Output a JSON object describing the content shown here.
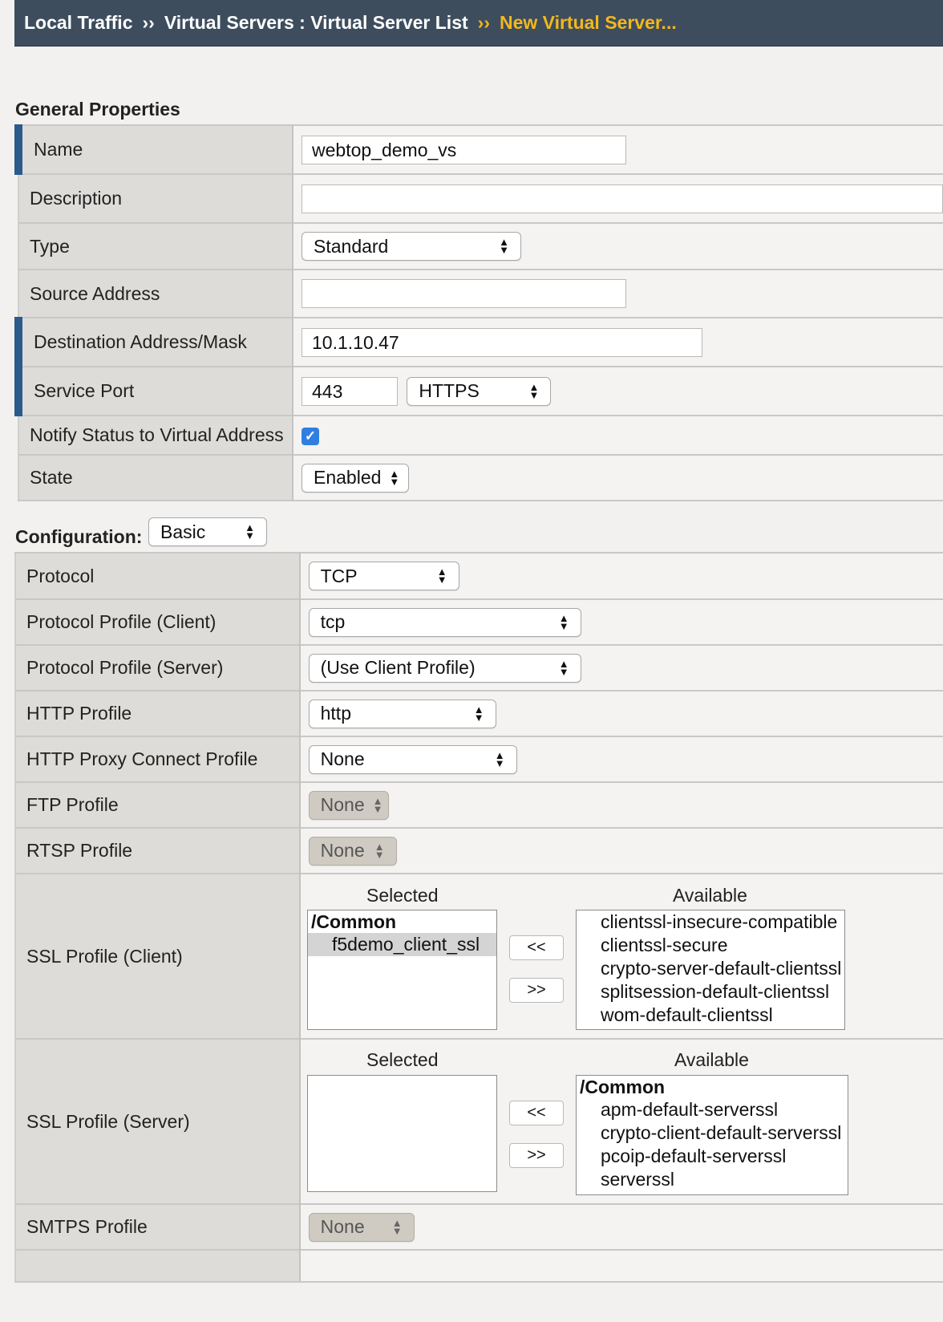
{
  "breadcrumb": {
    "item1": "Local Traffic",
    "sep": "››",
    "item2": "Virtual Servers : Virtual Server List",
    "current": "New Virtual Server..."
  },
  "general": {
    "title": "General Properties",
    "name_label": "Name",
    "name_value": "webtop_demo_vs",
    "description_label": "Description",
    "description_value": "",
    "type_label": "Type",
    "type_value": "Standard",
    "source_label": "Source Address",
    "source_value": "",
    "dest_label": "Destination Address/Mask",
    "dest_value": "10.1.10.47",
    "port_label": "Service Port",
    "port_value": "443",
    "port_service": "HTTPS",
    "notify_label": "Notify Status to Virtual Address",
    "notify_checked": true,
    "state_label": "State",
    "state_value": "Enabled"
  },
  "configuration": {
    "title": "Configuration:",
    "mode_value": "Basic",
    "protocol_label": "Protocol",
    "protocol_value": "TCP",
    "proto_client_label": "Protocol Profile (Client)",
    "proto_client_value": "tcp",
    "proto_server_label": "Protocol Profile (Server)",
    "proto_server_value": "(Use Client Profile)",
    "http_label": "HTTP Profile",
    "http_value": "http",
    "proxy_label": "HTTP Proxy Connect Profile",
    "proxy_value": "None",
    "ftp_label": "FTP Profile",
    "ftp_value": "None",
    "rtsp_label": "RTSP Profile",
    "rtsp_value": "None",
    "ssl_client_label": "SSL Profile (Client)",
    "ssl_server_label": "SSL Profile (Server)",
    "smtps_label": "SMTPS Profile",
    "smtps_value": "None",
    "selected_heading": "Selected",
    "available_heading": "Available",
    "move_left": "<<",
    "move_right": ">>",
    "ssl_client_selected_group": "/Common",
    "ssl_client_selected": [
      "f5demo_client_ssl"
    ],
    "ssl_client_available": [
      "clientssl-insecure-compatible",
      "clientssl-secure",
      "crypto-server-default-clientssl",
      "splitsession-default-clientssl",
      "wom-default-clientssl"
    ],
    "ssl_server_available_group": "/Common",
    "ssl_server_available": [
      "apm-default-serverssl",
      "crypto-client-default-serverssl",
      "pcoip-default-serverssl",
      "serverssl"
    ]
  }
}
